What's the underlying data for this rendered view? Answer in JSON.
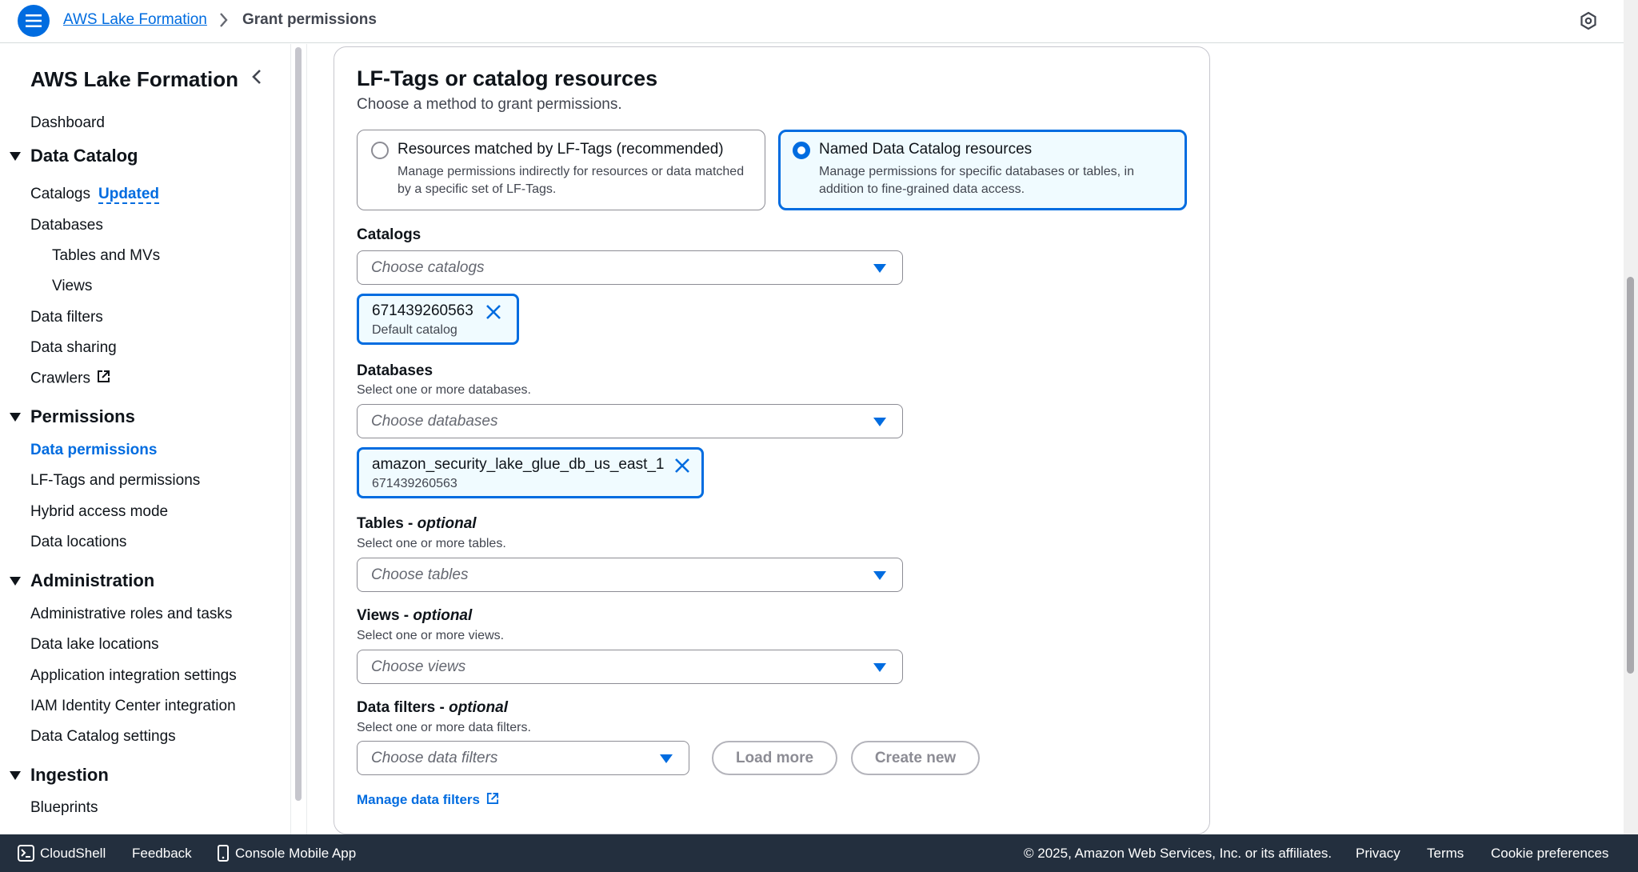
{
  "header": {
    "breadcrumb_root": "AWS Lake Formation",
    "breadcrumb_current": "Grant permissions",
    "icons": [
      "menu-icon",
      "chevron-right-icon",
      "settings-icon"
    ]
  },
  "sidebar": {
    "title": "AWS Lake Formation",
    "dashboard": "Dashboard",
    "sections": {
      "data_catalog": "Data Catalog",
      "permissions": "Permissions",
      "administration": "Administration",
      "ingestion": "Ingestion"
    },
    "items": {
      "catalogs": "Catalogs",
      "catalogs_badge": "Updated",
      "databases": "Databases",
      "tables_mvs": "Tables and MVs",
      "views": "Views",
      "data_filters": "Data filters",
      "data_sharing": "Data sharing",
      "crawlers": "Crawlers",
      "data_permissions": "Data permissions",
      "lf_tags": "LF-Tags and permissions",
      "hybrid": "Hybrid access mode",
      "data_locations": "Data locations",
      "admin_roles": "Administrative roles and tasks",
      "lake_locations": "Data lake locations",
      "app_integration": "Application integration settings",
      "iam_identity": "IAM Identity Center integration",
      "catalog_settings": "Data Catalog settings",
      "blueprints": "Blueprints"
    }
  },
  "panel": {
    "title": "LF-Tags or catalog resources",
    "description": "Choose a method to grant permissions.",
    "options": [
      {
        "label": "Resources matched by LF-Tags (recommended)",
        "desc": "Manage permissions indirectly for resources or data matched by a specific set of LF-Tags.",
        "selected": false
      },
      {
        "label": "Named Data Catalog resources",
        "desc": "Manage permissions for specific databases or tables, in addition to fine-grained data access.",
        "selected": true
      }
    ],
    "catalogs": {
      "label": "Catalogs",
      "placeholder": "Choose catalogs",
      "token_main": "671439260563",
      "token_sub": "Default catalog"
    },
    "databases": {
      "label": "Databases",
      "desc": "Select one or more databases.",
      "placeholder": "Choose databases",
      "token_main": "amazon_security_lake_glue_db_us_east_1",
      "token_sub": "671439260563"
    },
    "tables": {
      "label": "Tables - ",
      "optional": "optional",
      "desc": "Select one or more tables.",
      "placeholder": "Choose tables"
    },
    "views": {
      "label": "Views - ",
      "optional": "optional",
      "desc": "Select one or more views.",
      "placeholder": "Choose views"
    },
    "data_filters": {
      "label": "Data filters - ",
      "optional": "optional",
      "desc": "Select one or more data filters.",
      "placeholder": "Choose data filters",
      "load_more": "Load more",
      "create_new": "Create new"
    },
    "manage_link": "Manage data filters"
  },
  "footer": {
    "cloudshell": "CloudShell",
    "feedback": "Feedback",
    "mobile_app": "Console Mobile App",
    "copyright": "© 2025, Amazon Web Services, Inc. or its affiliates.",
    "privacy": "Privacy",
    "terms": "Terms",
    "cookies": "Cookie preferences"
  },
  "colors": {
    "accent": "#006ce0",
    "footer_bg": "#232f3e",
    "selected_bg": "#f0fbff"
  }
}
